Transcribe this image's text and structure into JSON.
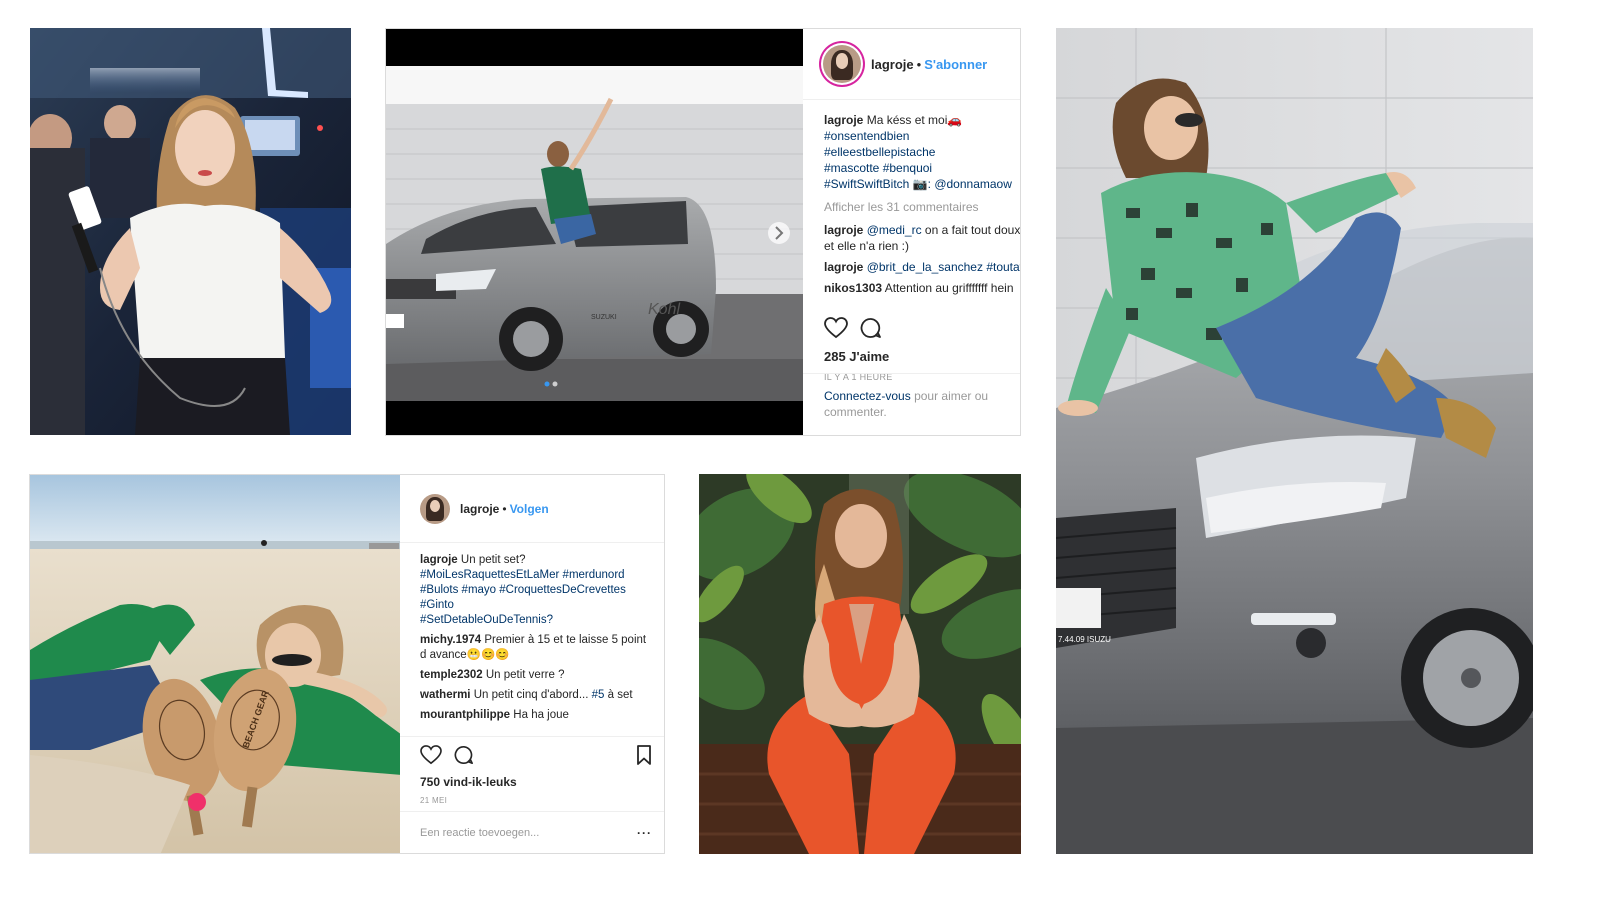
{
  "post1": {
    "username": "lagroje",
    "follow_label": "S'abonner",
    "caption_text": "Ma késs et moi",
    "car_emoji": "🚗",
    "hashtags": [
      "#onsentendbien",
      "#elleestbellepistache",
      "#mascotte #benquoi",
      "#SwiftSwiftBitch"
    ],
    "credit": "📷: @donnamaow",
    "view_comments": "Afficher les 31 commentaires",
    "comments": [
      {
        "user": "lagroje",
        "mention": "@medi_rc",
        "text": "on a fait tout doux",
        "cont": "et elle n'a rien :)"
      },
      {
        "user": "lagroje",
        "mention": "@brit_de_la_sanchez",
        "text": "#toutaf"
      },
      {
        "user": "nikos1303",
        "mention": "",
        "text": "Attention au grifffffff hein"
      }
    ],
    "likes": "285 J'aime",
    "time": "IL Y A 1 HEURE",
    "login_link": "Connectez-vous",
    "login_rest": "pour aimer ou commenter.",
    "carousel_dots": 2,
    "car_plate": "Kohl",
    "car_brand": "SUZUKI"
  },
  "post2": {
    "username": "lagroje",
    "follow_label": "Volgen",
    "caption_text": "Un petit set?",
    "hashtags": [
      "#MoiLesRaquettesEtLaMer #merdunord",
      "#Bulots #mayo #CroquettesDeCrevettes",
      "#Ginto",
      "#SetDetableOuDeTennis?"
    ],
    "comments": [
      {
        "user": "michy.1974",
        "text": "Premier à 15 et te laisse 5 point",
        "cont": "d avance😬😊😊"
      },
      {
        "user": "temple2302",
        "text": "Un petit verre ?"
      },
      {
        "user": "wathermi",
        "text": "Un petit cinq d'abord...",
        "tag": "#5",
        "after": "à set"
      },
      {
        "user": "mourantphilippe",
        "text": "Ha ha joue"
      }
    ],
    "likes": "750 vind-ik-leuks",
    "time": "21 MEI",
    "comment_placeholder": "Een reactie toevoegen...",
    "more": "···",
    "racket_text": "BEACH GEAR"
  },
  "photos": {
    "plate_text": "7.44.09 ISUZU"
  },
  "colors": {
    "link_blue": "#3897f0",
    "hashtag_blue": "#003569",
    "border": "#dbdbdb",
    "jumpsuit_orange": "#e8552b",
    "shirt_green": "#1f8a4c"
  },
  "icons": [
    "heart-icon",
    "comment-icon",
    "bookmark-icon",
    "chevron-right-icon",
    "more-icon"
  ]
}
